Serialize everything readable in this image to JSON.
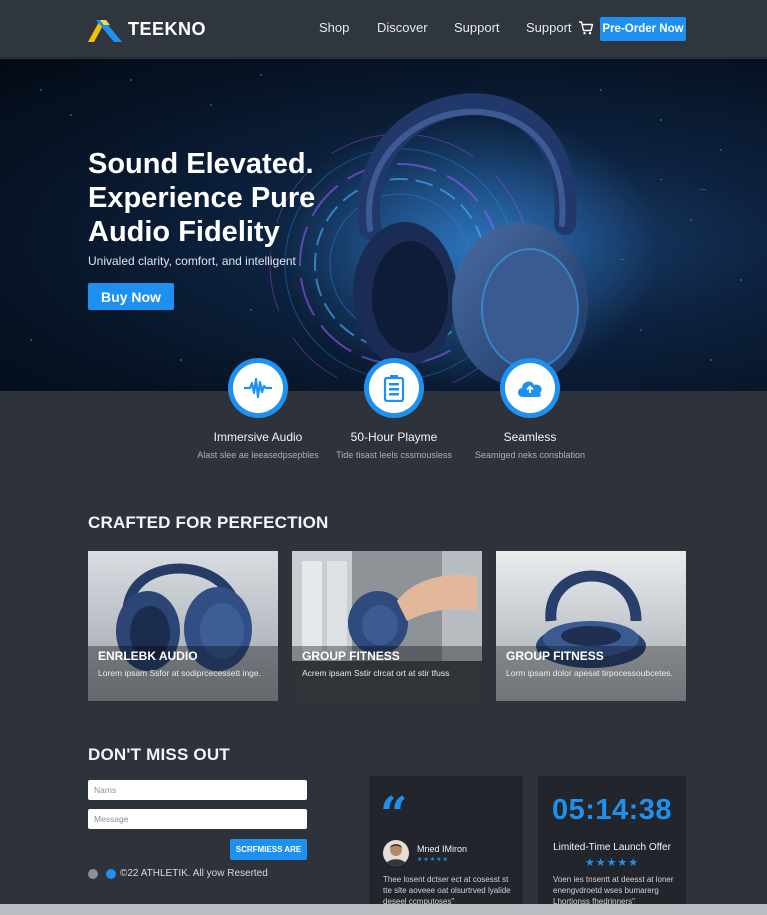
{
  "header": {
    "brand": "TEEKNO",
    "nav": [
      "Shop",
      "Discover",
      "Support",
      "Support"
    ],
    "preorder_label": "Pre-Order Now"
  },
  "hero": {
    "title": "Sound Elevated. Experience Pure Audio Fidelity",
    "subtitle": "Univaled clarity, comfort, and intelligent",
    "cta_label": "Buy Now"
  },
  "features": [
    {
      "icon": "waveform-icon",
      "title": "Immersive Audio",
      "desc": "Alast slee ae leeasedpsepbles"
    },
    {
      "icon": "battery-icon",
      "title": "50-Hour Playme",
      "desc": "Tide tisast leels cssmousless"
    },
    {
      "icon": "cloud-icon",
      "title": "Seamless",
      "desc": "Seamiged neks consblation"
    }
  ],
  "crafted": {
    "title": "CRAFTED FOR PERFECTION",
    "cards": [
      {
        "title": "ENRLEBK AUDIO",
        "desc": "Lorem ipsam Ssfor at sodiprcecessett inge."
      },
      {
        "title": "GROUP FITNESS",
        "desc": "Acrem ipsam Sstir clrcat ort at stir tfuss"
      },
      {
        "title": "GROUP FITNESS",
        "desc": "Lorm ipsam dolor apesat tirpocessoubcetes."
      }
    ]
  },
  "signup": {
    "title": "DON'T MISS OUT",
    "name_placeholder": "Nams",
    "message_placeholder": "Message",
    "send_label": "SCRFMIESS ARE",
    "copyright": "©22 ATHLETIK. All yow Reserted"
  },
  "testimonial": {
    "quote_mark": "“",
    "name": "Mned IMiron",
    "stars": "★★★★★",
    "text": "Thee losent dctser ect at cosesst st tte slte aoveee oat olsurtrved lyalide deseel ccmputoses\""
  },
  "offer": {
    "countdown": "05:14:38",
    "title": "Limited-Time Launch Offer",
    "stars": "★★★★★",
    "text": "Voen ies tnsentt at deesst at loner enengvdroetd wses bumarerg Lhortionss fhedrinners\""
  },
  "colors": {
    "accent": "#1e90f0",
    "background": "#2e333b",
    "panel": "#22262c"
  }
}
